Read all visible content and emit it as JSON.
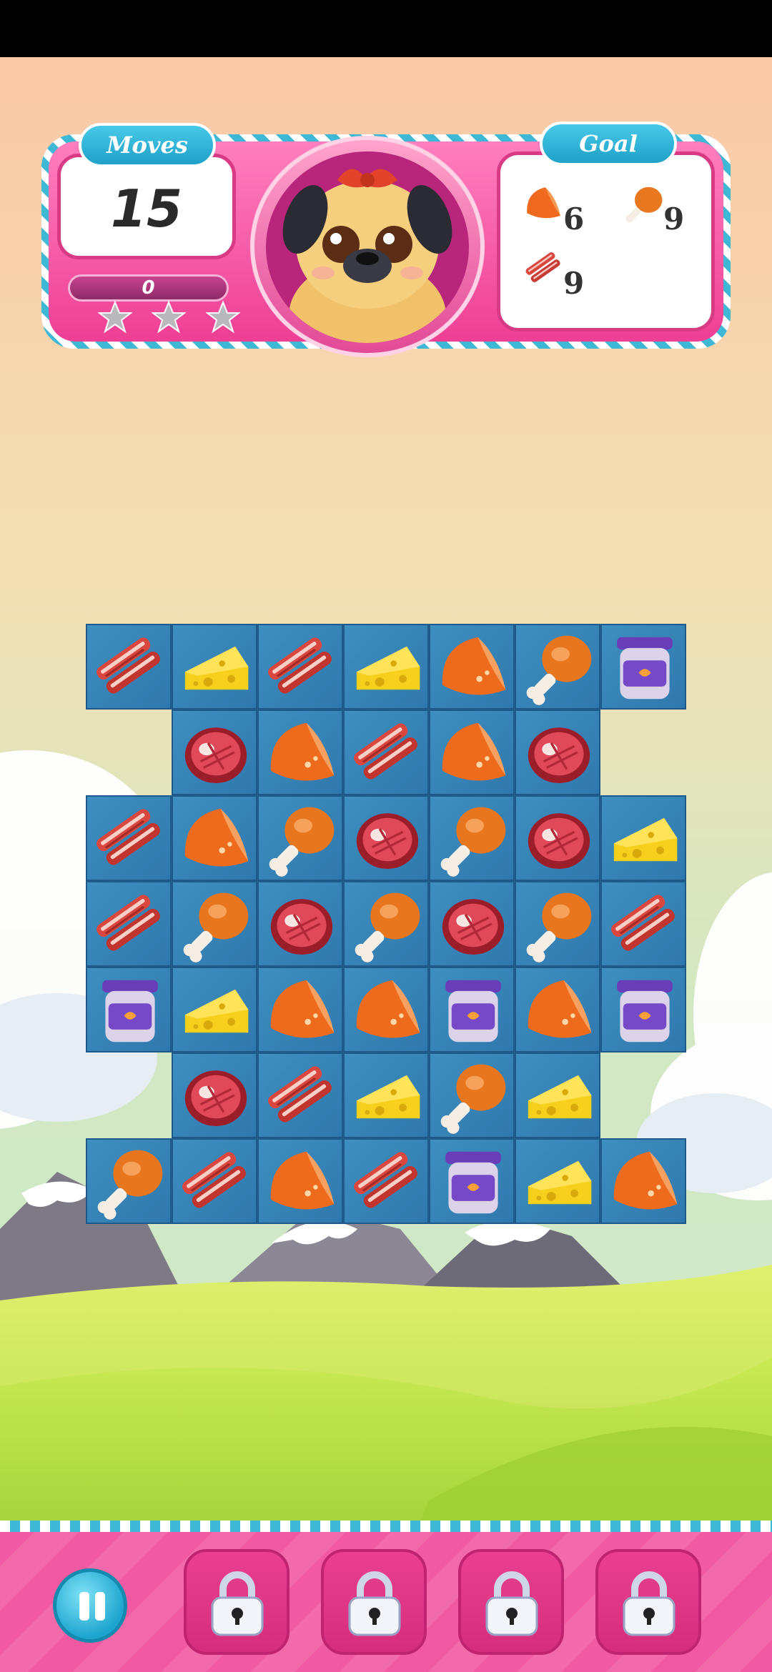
{
  "hud": {
    "moves_label": "Moves",
    "moves_value": "15",
    "score_value": "0",
    "stars_earned": 0,
    "stars_total": 3,
    "goal_label": "Goal",
    "goals": [
      {
        "item": "pumpkin-slice",
        "count": "6"
      },
      {
        "item": "chicken-leg",
        "count": "9"
      },
      {
        "item": "bacon",
        "count": "9"
      }
    ]
  },
  "board": {
    "rows": [
      [
        "bacon",
        "cheese",
        "bacon",
        "cheese",
        "pumpkin",
        "chicken",
        "jar"
      ],
      [
        "empty",
        "steak",
        "pumpkin",
        "bacon",
        "pumpkin",
        "steak",
        "empty"
      ],
      [
        "bacon",
        "pumpkin",
        "chicken",
        "steak",
        "chicken",
        "steak",
        "cheese"
      ],
      [
        "bacon",
        "chicken",
        "steak",
        "chicken",
        "steak",
        "chicken",
        "bacon"
      ],
      [
        "jar",
        "cheese",
        "pumpkin",
        "pumpkin",
        "jar",
        "pumpkin",
        "jar"
      ],
      [
        "empty",
        "steak",
        "bacon",
        "cheese",
        "chicken",
        "cheese",
        "empty"
      ],
      [
        "chicken",
        "bacon",
        "pumpkin",
        "bacon",
        "jar",
        "cheese",
        "pumpkin"
      ]
    ]
  },
  "boosters": [
    {
      "name": "booster-slot-1",
      "locked": true,
      "icon": "lock-icon"
    },
    {
      "name": "booster-slot-2",
      "locked": true,
      "icon": "lock-icon"
    },
    {
      "name": "booster-slot-3",
      "locked": true,
      "icon": "lock-icon"
    },
    {
      "name": "booster-slot-4",
      "locked": true,
      "icon": "lock-icon"
    }
  ],
  "controls": {
    "pause_icon": "pause-icon"
  },
  "colors": {
    "hud_pink": "#ee3f94",
    "tag_blue": "#1fa1c9",
    "board_blue": "#2f78ad"
  }
}
